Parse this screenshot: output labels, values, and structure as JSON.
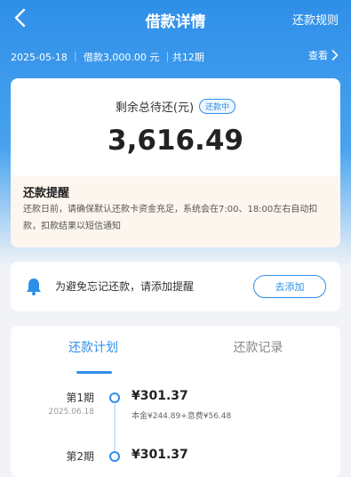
{
  "header": {
    "title": "借款详情",
    "rule_link": "还款规则"
  },
  "summary": {
    "text": "2025-05-18 ｜ 借款3,000.00 元 ｜共12期",
    "view_label": "查看"
  },
  "main": {
    "remain_label": "剩余总待还(元)",
    "status_badge": "还款中",
    "amount": "3,616.49",
    "notice_title": "还款提醒",
    "notice_body": "还款日前，请确保默认还款卡资金充足，系统会在7:00、18:00左右自动扣款，扣款结果以短信通知"
  },
  "reminder": {
    "text": "为避免忘记还款，请添加提醒",
    "button": "去添加"
  },
  "tabs": [
    {
      "label": "还款计划"
    },
    {
      "label": "还款记录"
    }
  ],
  "plan": [
    {
      "label": "第1期",
      "date": "2025.06.18",
      "amount": "¥301.37",
      "detail": "本金¥244.89+息费¥56.48"
    },
    {
      "label": "第2期",
      "amount": "¥301.37"
    }
  ],
  "colors": {
    "accent": "#2f8fe8",
    "notice_bg": "#fdf6ee"
  }
}
